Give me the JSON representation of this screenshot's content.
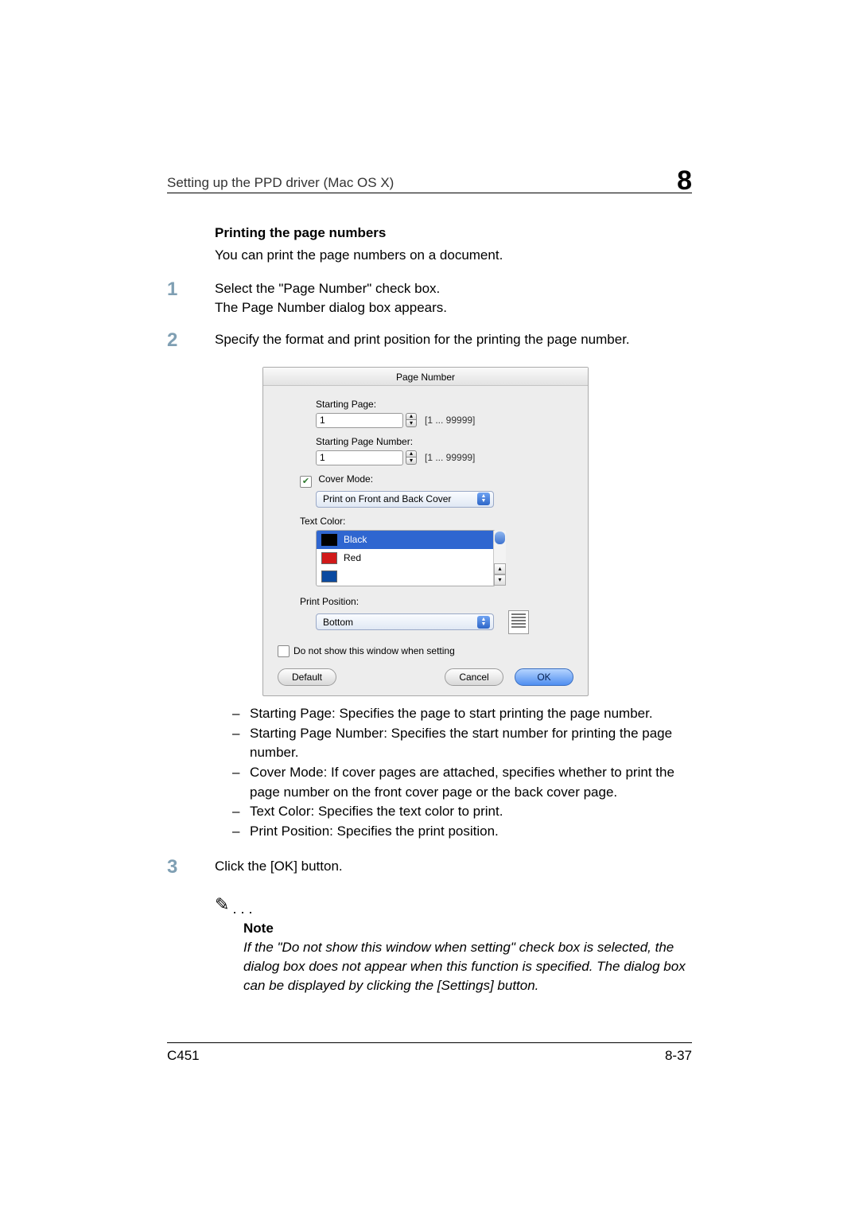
{
  "header": {
    "title": "Setting up the PPD driver (Mac OS X)",
    "chapter": "8"
  },
  "section": {
    "heading": "Printing the page numbers",
    "intro": "You can print the page numbers on a document.",
    "steps": [
      {
        "num": "1",
        "lines": [
          "Select the \"Page Number\" check box.",
          "The Page Number dialog box appears."
        ]
      },
      {
        "num": "2",
        "lines": [
          "Specify the format and print position for the printing the page number."
        ]
      },
      {
        "num": "3",
        "lines": [
          "Click the [OK] button."
        ]
      }
    ],
    "bullets": [
      "Starting Page: Specifies the page to start printing the page number.",
      "Starting Page Number: Specifies the start number for printing the page number.",
      "Cover Mode: If cover pages are attached, specifies whether to print the page number on the front cover page or the back cover page.",
      "Text Color: Specifies the text color to print.",
      "Print Position: Specifies the print position."
    ],
    "note": {
      "label": "Note",
      "body": "If the \"Do not show this window when setting\" check box is selected, the dialog box does not appear when this function is specified. The dialog box can be displayed by clicking the [Settings] button."
    }
  },
  "dialog": {
    "title": "Page Number",
    "startingPage": {
      "label": "Starting Page:",
      "value": "1",
      "range": "[1 ... 99999]"
    },
    "startingNum": {
      "label": "Starting Page Number:",
      "value": "1",
      "range": "[1 ... 99999]"
    },
    "coverMode": {
      "label": "Cover Mode:",
      "checked": true,
      "value": "Print on Front and Back Cover"
    },
    "textColor": {
      "label": "Text Color:",
      "options": [
        {
          "name": "Black",
          "hex": "#000000",
          "selected": true
        },
        {
          "name": "Red",
          "hex": "#d11a1a",
          "selected": false
        }
      ]
    },
    "printPosition": {
      "label": "Print Position:",
      "value": "Bottom"
    },
    "doNotShow": {
      "label": "Do not show this window when setting",
      "checked": false
    },
    "buttons": {
      "default": "Default",
      "cancel": "Cancel",
      "ok": "OK"
    }
  },
  "footer": {
    "left": "C451",
    "right": "8-37"
  }
}
